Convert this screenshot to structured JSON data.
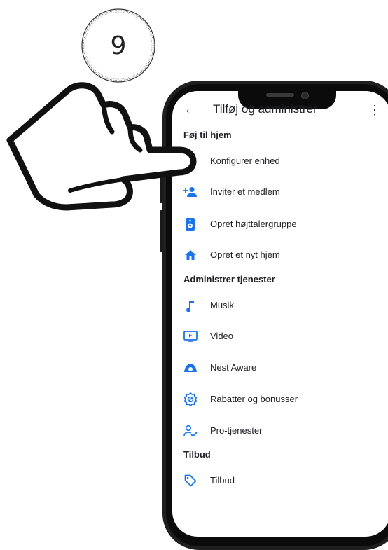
{
  "step": {
    "number": "9"
  },
  "topbar": {
    "title": "Tilføj og administrer",
    "back_icon": "arrow-left-icon",
    "menu_icon": "more-vert-icon"
  },
  "sections": [
    {
      "title": "Føj til hjem",
      "items": [
        {
          "label": "Konfigurer enhed",
          "icon": "add-circle-icon"
        },
        {
          "label": "Inviter et medlem",
          "icon": "person-add-icon"
        },
        {
          "label": "Opret højttalergruppe",
          "icon": "speaker-group-icon"
        },
        {
          "label": "Opret et nyt hjem",
          "icon": "home-icon"
        }
      ]
    },
    {
      "title": "Administrer tjenester",
      "items": [
        {
          "label": "Musik",
          "icon": "music-note-icon"
        },
        {
          "label": "Video",
          "icon": "video-icon"
        },
        {
          "label": "Nest Aware",
          "icon": "nest-aware-icon"
        },
        {
          "label": "Rabatter og bonusser",
          "icon": "offers-badge-icon"
        },
        {
          "label": "Pro-tjenester",
          "icon": "pro-services-icon"
        }
      ]
    },
    {
      "title": "Tilbud",
      "items": [
        {
          "label": "Tilbud",
          "icon": "tag-icon"
        }
      ]
    }
  ],
  "colors": {
    "accent": "#1a73e8",
    "text": "#202124",
    "phone_body": "#1f1f1f"
  }
}
